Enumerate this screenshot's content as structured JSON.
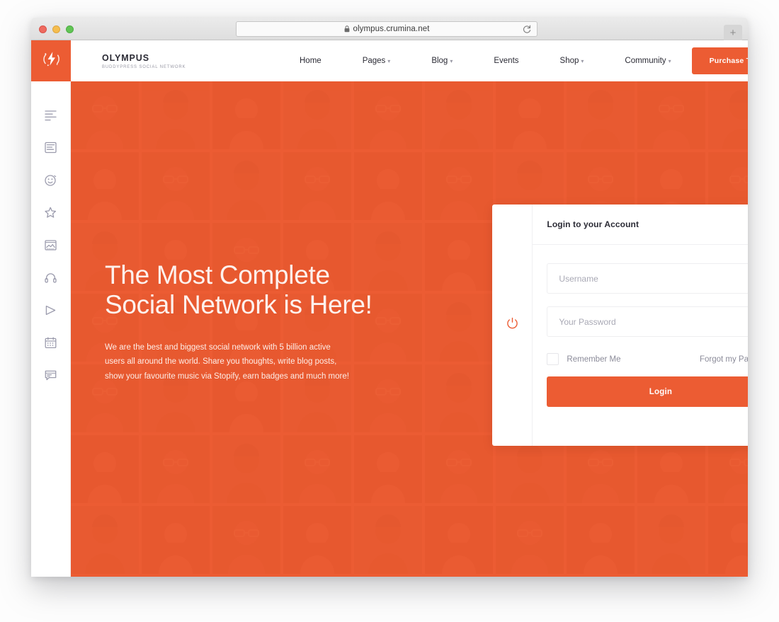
{
  "browser": {
    "url": "olympus.crumina.net",
    "lock_icon": "lock-icon",
    "reload_icon": "reload-icon",
    "newtab_label": "+",
    "traffic_lights": [
      "close",
      "minimize",
      "maximize"
    ]
  },
  "brand": {
    "logo_icon": "lightning-bolt-logo",
    "name": "OLYMPUS",
    "tagline": "BUDDYPRESS SOCIAL NETWORK"
  },
  "nav": {
    "items": [
      {
        "label": "Home",
        "has_caret": false,
        "icon": ""
      },
      {
        "label": "Pages",
        "has_caret": true,
        "icon": "chevron-down-icon"
      },
      {
        "label": "Blog",
        "has_caret": true,
        "icon": "chevron-down-icon"
      },
      {
        "label": "Events",
        "has_caret": false,
        "icon": ""
      },
      {
        "label": "Shop",
        "has_caret": true,
        "icon": "chevron-down-icon"
      },
      {
        "label": "Community",
        "has_caret": true,
        "icon": "chevron-down-icon"
      }
    ],
    "cta_label": "Purchase Theme"
  },
  "sidebar": {
    "items": [
      {
        "icon": "newsfeed-list-icon",
        "name": "sidebar-item-newsfeed"
      },
      {
        "icon": "posts-page-icon",
        "name": "sidebar-item-posts"
      },
      {
        "icon": "smiley-face-icon",
        "name": "sidebar-item-friends"
      },
      {
        "icon": "star-icon",
        "name": "sidebar-item-favourites"
      },
      {
        "icon": "photo-gallery-icon",
        "name": "sidebar-item-photos"
      },
      {
        "icon": "headphones-icon",
        "name": "sidebar-item-music"
      },
      {
        "icon": "play-video-icon",
        "name": "sidebar-item-videos"
      },
      {
        "icon": "calendar-icon",
        "name": "sidebar-item-events"
      },
      {
        "icon": "chat-forum-icon",
        "name": "sidebar-item-forums"
      }
    ]
  },
  "hero": {
    "title_line1": "The Most Complete",
    "title_line2": "Social Network is Here!",
    "subtitle": "We are the best and biggest social network with 5 billion active users all around the world. Share you thoughts, write blog posts, show your favourite music via Stopify, earn badges and much more!"
  },
  "login_card": {
    "power_icon": "power-on-off-icon",
    "title": "Login to your Account",
    "username": {
      "value": "",
      "placeholder": "Username"
    },
    "password": {
      "value": "",
      "placeholder": "Your Password"
    },
    "remember_label": "Remember Me",
    "remember_checked": false,
    "forgot_label": "Forgot my Password",
    "submit_label": "Login"
  },
  "colors": {
    "accent": "#ec5c33",
    "hero_bg": "#ec5c33",
    "text_dark": "#2b2b35",
    "text_muted": "#8b8b99",
    "border": "#eeeef0",
    "page_bg": "#fdfdfd"
  }
}
